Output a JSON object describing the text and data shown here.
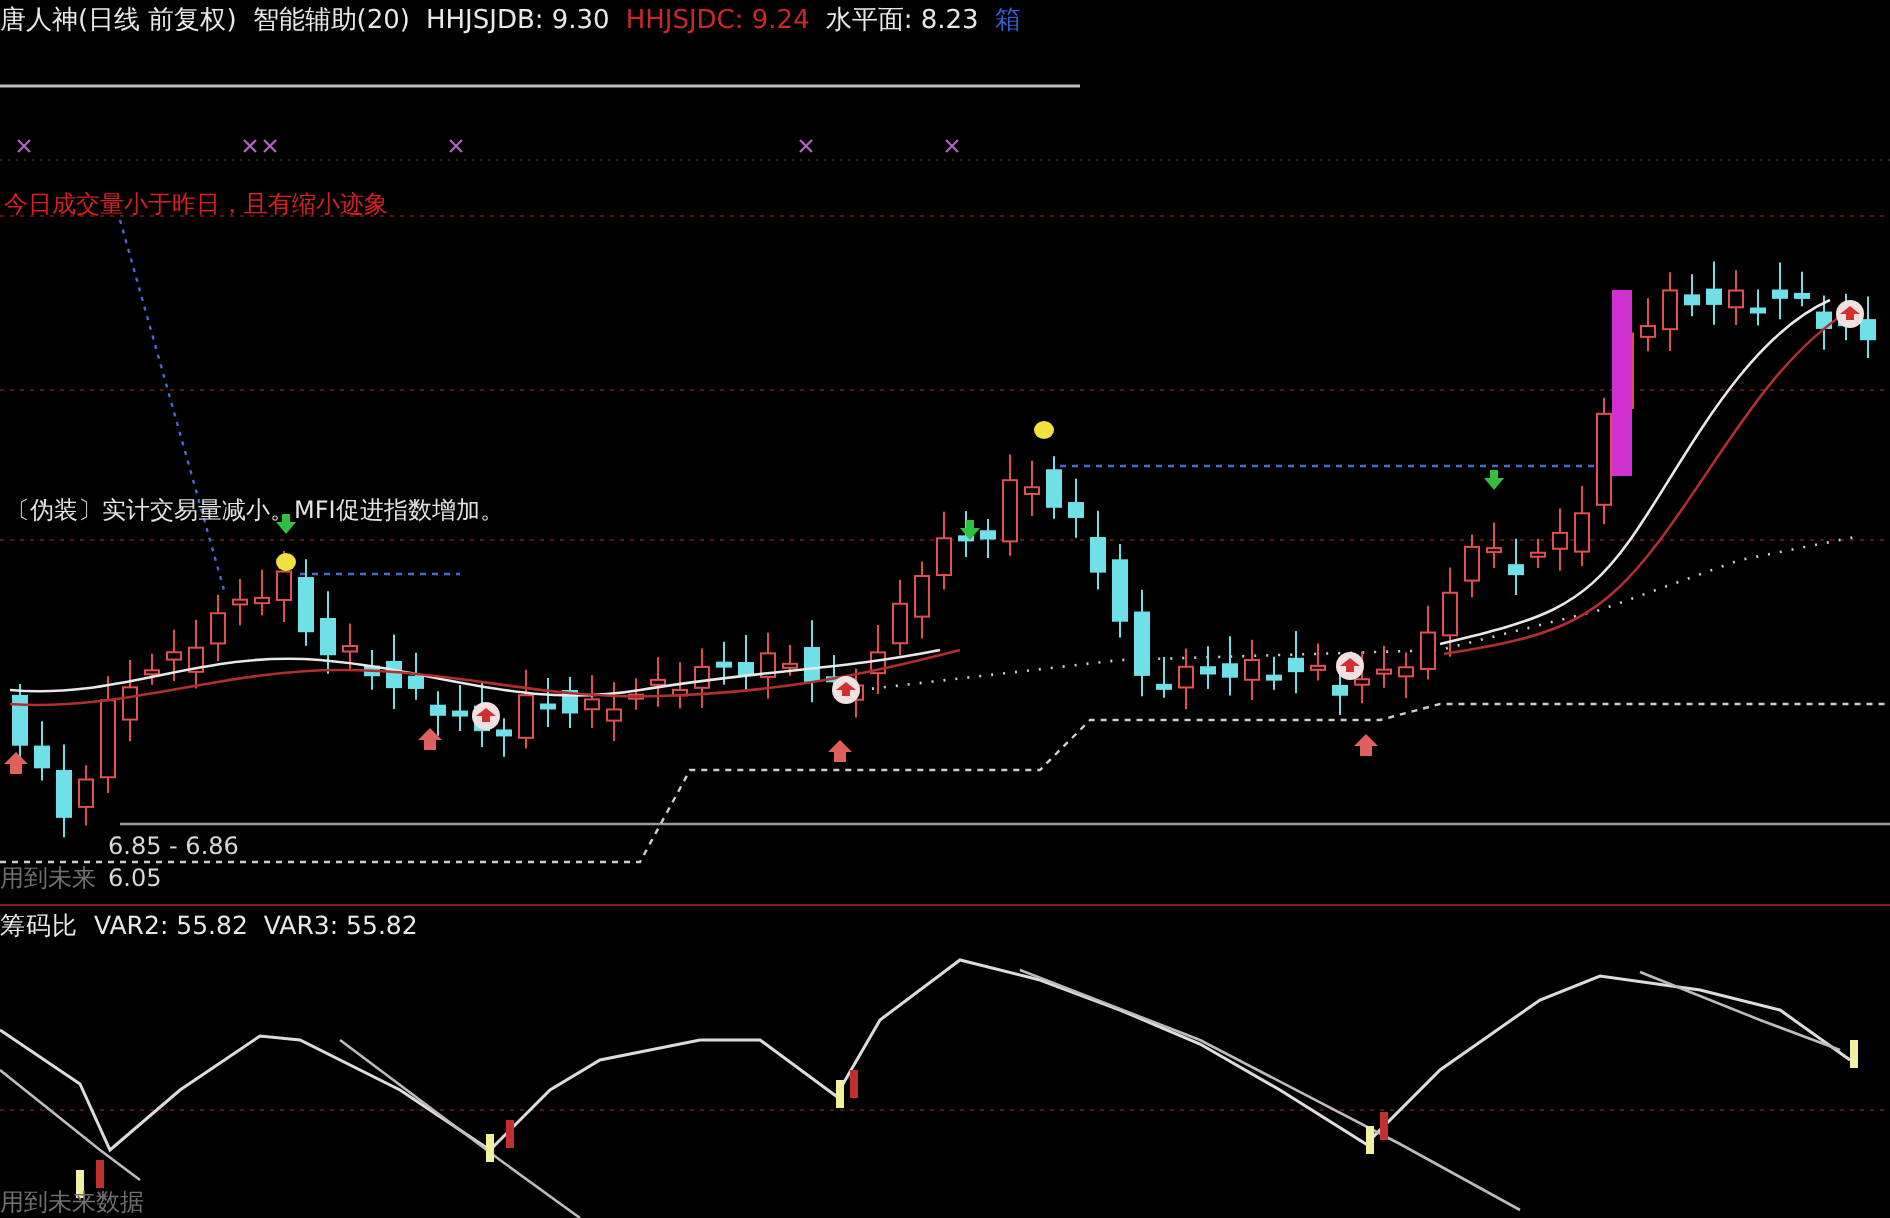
{
  "header": {
    "title": "唐人神(日线 前复权)",
    "indicator": "智能辅助(20)",
    "values": [
      {
        "text": "HHJSJDB: 9.30",
        "color": "#e8e8e8"
      },
      {
        "text": "HHJSJDC: 9.24",
        "color": "#c8282a"
      },
      {
        "text": "水平面: 8.23",
        "color": "#e8e8e8"
      },
      {
        "text": "箱",
        "color": "#3a5cd0"
      }
    ]
  },
  "main_chart": {
    "notes": [
      {
        "text": "今日成交量小于昨日，且有缩小迹象",
        "color": "#d82020"
      },
      {
        "text": "〔伪装〕实计交易量减小。MFI促进指数增加。",
        "color": "#e4e4e4"
      }
    ],
    "range_label": "6.85 - 6.86",
    "future_label": "用到未来",
    "price_label": "6.05"
  },
  "sub_chart": {
    "title": "筹码比",
    "values": [
      "VAR2: 55.82",
      "VAR3: 55.82"
    ],
    "footer": "用到未来数据"
  }
}
